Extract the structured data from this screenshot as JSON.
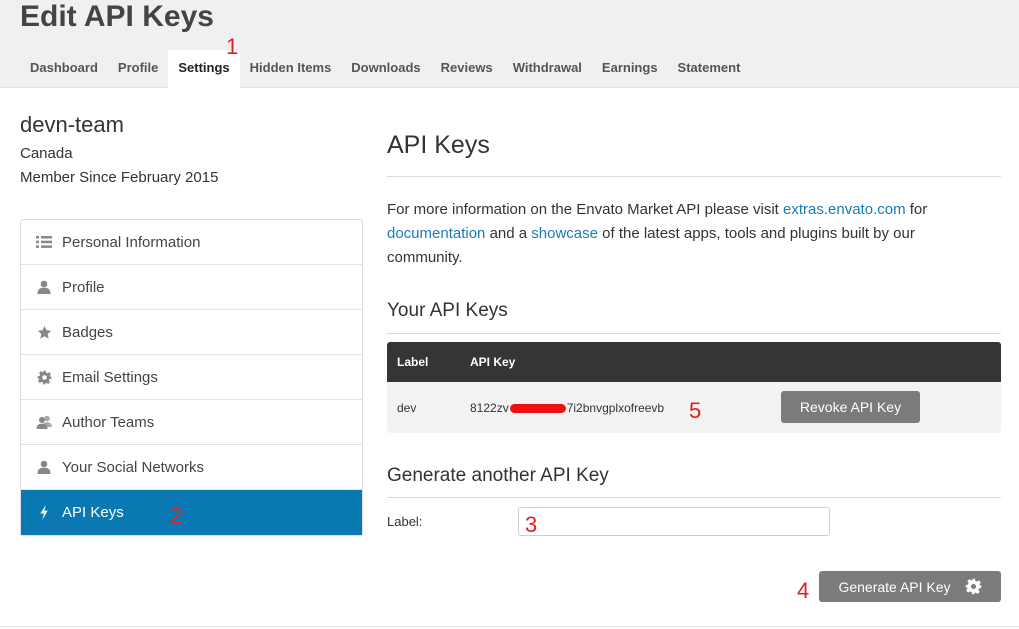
{
  "page_title": "Edit API Keys",
  "tabs": [
    {
      "label": "Dashboard"
    },
    {
      "label": "Profile"
    },
    {
      "label": "Settings"
    },
    {
      "label": "Hidden Items"
    },
    {
      "label": "Downloads"
    },
    {
      "label": "Reviews"
    },
    {
      "label": "Withdrawal"
    },
    {
      "label": "Earnings"
    },
    {
      "label": "Statement"
    }
  ],
  "active_tab": "Settings",
  "profile": {
    "username": "devn-team",
    "country": "Canada",
    "member_since": "Member Since February 2015"
  },
  "sidebar": {
    "items": [
      {
        "label": "Personal Information",
        "icon": "list-icon"
      },
      {
        "label": "Profile",
        "icon": "user-icon"
      },
      {
        "label": "Badges",
        "icon": "star-icon"
      },
      {
        "label": "Email Settings",
        "icon": "gear-icon"
      },
      {
        "label": "Author Teams",
        "icon": "team-icon"
      },
      {
        "label": "Your Social Networks",
        "icon": "user-icon"
      },
      {
        "label": "API Keys",
        "icon": "bolt-icon"
      }
    ],
    "active": "API Keys"
  },
  "main": {
    "title": "API Keys",
    "info": {
      "text1": "For more information on the Envato Market API please visit ",
      "link1": "extras.envato.com",
      "text2": " for ",
      "link2": "documentation",
      "text3": " and a ",
      "link3": "showcase",
      "text4": " of the latest apps, tools and plugins built by our community."
    },
    "your_keys_title": "Your API Keys",
    "table": {
      "headers": [
        "Label",
        "API Key"
      ],
      "rows": [
        {
          "label": "dev",
          "key_prefix": "8122zv",
          "key_suffix": "7i2bnvgplxofreevb",
          "action": "Revoke API Key"
        }
      ]
    },
    "generate_title": "Generate another API Key",
    "label_field_label": "Label:",
    "label_field_value": "",
    "generate_button": "Generate API Key"
  },
  "annotations": [
    "1",
    "2",
    "3",
    "4",
    "5"
  ],
  "colors": {
    "accent": "#0a79b3",
    "link": "#1a7cb7",
    "button": "#7b7b7b",
    "table_header": "#353535",
    "annotation": "#e02020"
  }
}
